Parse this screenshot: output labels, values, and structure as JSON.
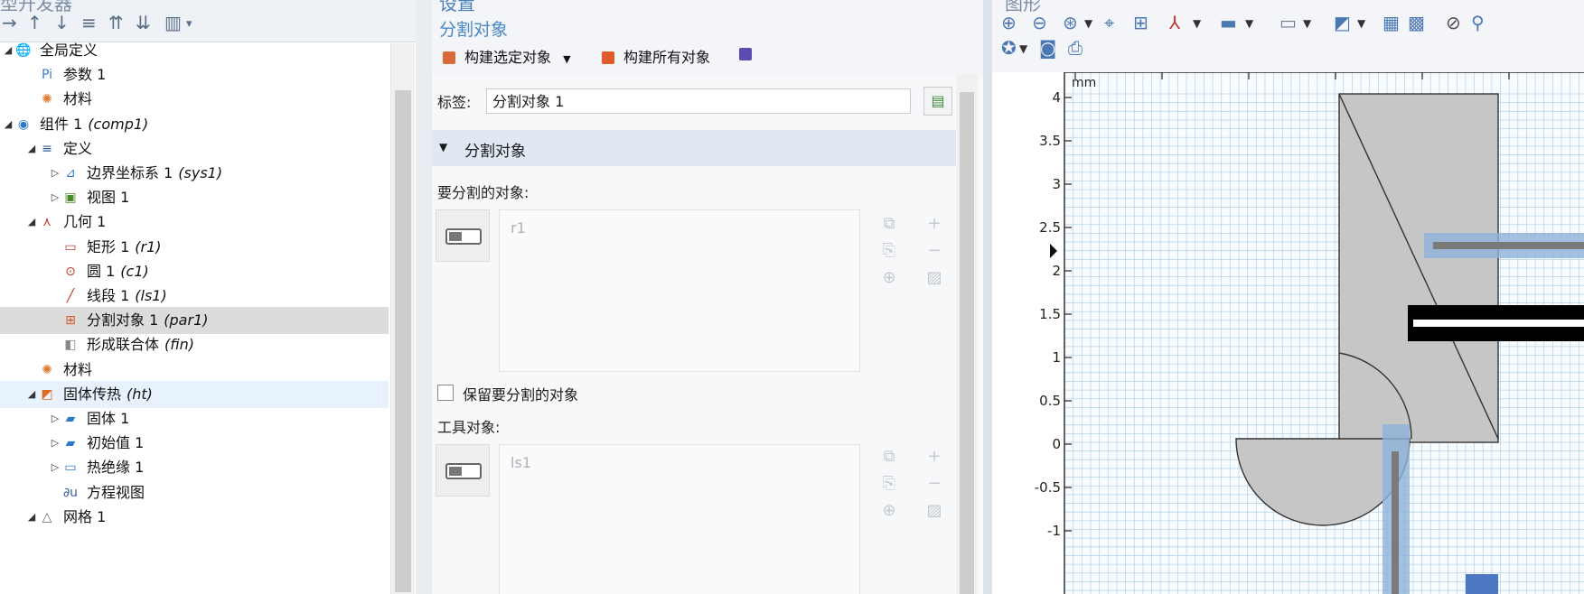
{
  "left": {
    "title": "型开发器",
    "toolbar": [
      "→",
      "↑",
      "↓",
      "≡",
      "⇈",
      "⇊",
      "▥",
      "▾"
    ],
    "tree": [
      {
        "label": "全局定义",
        "sub": "",
        "expander": "◢",
        "icon": "globe-icon",
        "iconGlyph": "🌐",
        "level": 0
      },
      {
        "label": "参数 1",
        "sub": "",
        "expander": "",
        "icon": "parameters-icon",
        "iconGlyph": "Pi",
        "level": 1
      },
      {
        "label": "材料",
        "sub": "",
        "expander": "",
        "icon": "materials-icon",
        "iconGlyph": "✺",
        "level": 1
      },
      {
        "label": "组件 1",
        "sub": "(comp1)",
        "expander": "◢",
        "icon": "component-icon",
        "iconGlyph": "◉",
        "level": 0
      },
      {
        "label": "定义",
        "sub": "",
        "expander": "◢",
        "icon": "definitions-icon",
        "iconGlyph": "≡",
        "level": 1
      },
      {
        "label": "边界坐标系 1",
        "sub": "(sys1)",
        "expander": "▷",
        "icon": "coordinate-system-icon",
        "iconGlyph": "⊿",
        "level": 2
      },
      {
        "label": "视图 1",
        "sub": "",
        "expander": "▷",
        "icon": "view-icon",
        "iconGlyph": "▣",
        "level": 2
      },
      {
        "label": "几何 1",
        "sub": "",
        "expander": "◢",
        "icon": "geometry-icon",
        "iconGlyph": "⋏",
        "level": 1
      },
      {
        "label": "矩形 1",
        "sub": "(r1)",
        "expander": "",
        "icon": "rectangle-icon",
        "iconGlyph": "▭",
        "level": 2
      },
      {
        "label": "圆 1",
        "sub": "(c1)",
        "expander": "",
        "icon": "circle-icon",
        "iconGlyph": "⊙",
        "level": 2
      },
      {
        "label": "线段 1",
        "sub": "(ls1)",
        "expander": "",
        "icon": "line-segment-icon",
        "iconGlyph": "╱",
        "level": 2
      },
      {
        "label": "分割对象 1",
        "sub": "(par1)",
        "expander": "",
        "icon": "partition-icon",
        "iconGlyph": "⊞",
        "level": 2,
        "selected": true
      },
      {
        "label": "形成联合体",
        "sub": "(fin)",
        "expander": "",
        "icon": "form-union-icon",
        "iconGlyph": "◧",
        "level": 2
      },
      {
        "label": "材料",
        "sub": "",
        "expander": "",
        "icon": "materials-icon",
        "iconGlyph": "✺",
        "level": 1
      },
      {
        "label": "固体传热",
        "sub": "(ht)",
        "expander": "◢",
        "icon": "heat-transfer-icon",
        "iconGlyph": "◩",
        "level": 1,
        "hover": true
      },
      {
        "label": "固体 1",
        "sub": "",
        "expander": "▷",
        "icon": "solid-icon",
        "iconGlyph": "▰",
        "level": 2
      },
      {
        "label": "初始值 1",
        "sub": "",
        "expander": "▷",
        "icon": "initial-values-icon",
        "iconGlyph": "▰",
        "level": 2
      },
      {
        "label": "热绝缘 1",
        "sub": "",
        "expander": "▷",
        "icon": "thermal-insulation-icon",
        "iconGlyph": "▭",
        "level": 2
      },
      {
        "label": "方程视图",
        "sub": "",
        "expander": "",
        "icon": "equation-view-icon",
        "iconGlyph": "∂u",
        "level": 2
      },
      {
        "label": "网格 1",
        "sub": "",
        "expander": "◢",
        "icon": "mesh-icon",
        "iconGlyph": "△",
        "level": 1
      }
    ]
  },
  "settings": {
    "title": "设置",
    "subtitle": "分割对象",
    "build_selected": "构建选定对象",
    "build_all": "构建所有对象",
    "label_caption": "标签:",
    "label_value": "分割对象 1",
    "section": "分割对象",
    "objects_caption": "要分割的对象:",
    "objects": [
      "r1"
    ],
    "keep_caption": "保留要分割的对象",
    "tools_caption": "工具对象:",
    "tools": [
      "ls1"
    ]
  },
  "graphics": {
    "title": "图形",
    "unit": "mm",
    "y_ticks": [
      "4",
      "3.5",
      "3",
      "2.5",
      "2",
      "1.5",
      "1",
      "0.5",
      "0",
      "-0.5",
      "-1"
    ],
    "colors": {
      "grid": "#b8d4ea",
      "shape": "#c6c6c6",
      "highlight": "#8fb1d9"
    }
  }
}
